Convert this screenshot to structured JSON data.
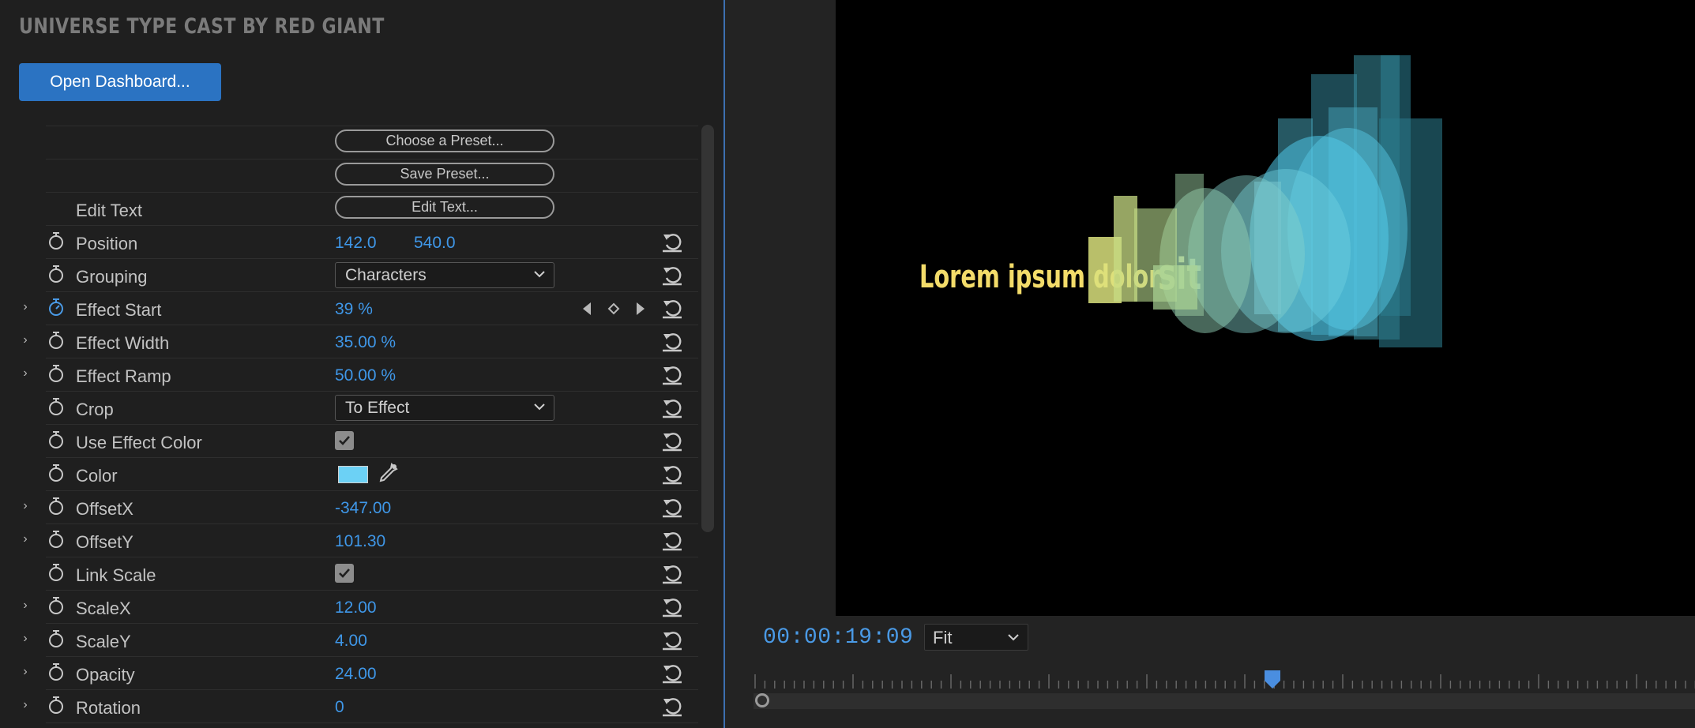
{
  "panel": {
    "effect_title": "UNIVERSE TYPE CAST BY RED GIANT",
    "dashboard_button": "Open Dashboard..."
  },
  "buttons": {
    "choose_preset": "Choose a Preset...",
    "save_preset": "Save Preset...",
    "edit_text": "Edit Text..."
  },
  "properties": {
    "edit_text": {
      "label": "Edit Text"
    },
    "position": {
      "label": "Position",
      "x": "142.0",
      "y": "540.0"
    },
    "grouping": {
      "label": "Grouping",
      "value": "Characters"
    },
    "effect_start": {
      "label": "Effect Start",
      "value": "39 %"
    },
    "effect_width": {
      "label": "Effect Width",
      "value": "35.00 %"
    },
    "effect_ramp": {
      "label": "Effect Ramp",
      "value": "50.00 %"
    },
    "crop": {
      "label": "Crop",
      "value": "To Effect"
    },
    "use_effect_color": {
      "label": "Use Effect Color"
    },
    "color": {
      "label": "Color",
      "swatch": "#6cd1f5"
    },
    "offset_x": {
      "label": "OffsetX",
      "value": "-347.00"
    },
    "offset_y": {
      "label": "OffsetY",
      "value": "101.30"
    },
    "link_scale": {
      "label": "Link Scale"
    },
    "scale_x": {
      "label": "ScaleX",
      "value": "12.00"
    },
    "scale_y": {
      "label": "ScaleY",
      "value": "4.00"
    },
    "opacity": {
      "label": "Opacity",
      "value": "24.00"
    },
    "rotation": {
      "label": "Rotation",
      "value": "0"
    }
  },
  "monitor": {
    "preview_text": "Lorem ipsum dolor",
    "preview_word": "sit",
    "timecode": "00:00:19:09",
    "zoom": "Fit"
  },
  "colors": {
    "accent_blue": "#2b73c2",
    "value_blue": "#3f97e8",
    "preview_yellow": "#f3dc6a",
    "preview_cyan": "#4fc6e8"
  }
}
